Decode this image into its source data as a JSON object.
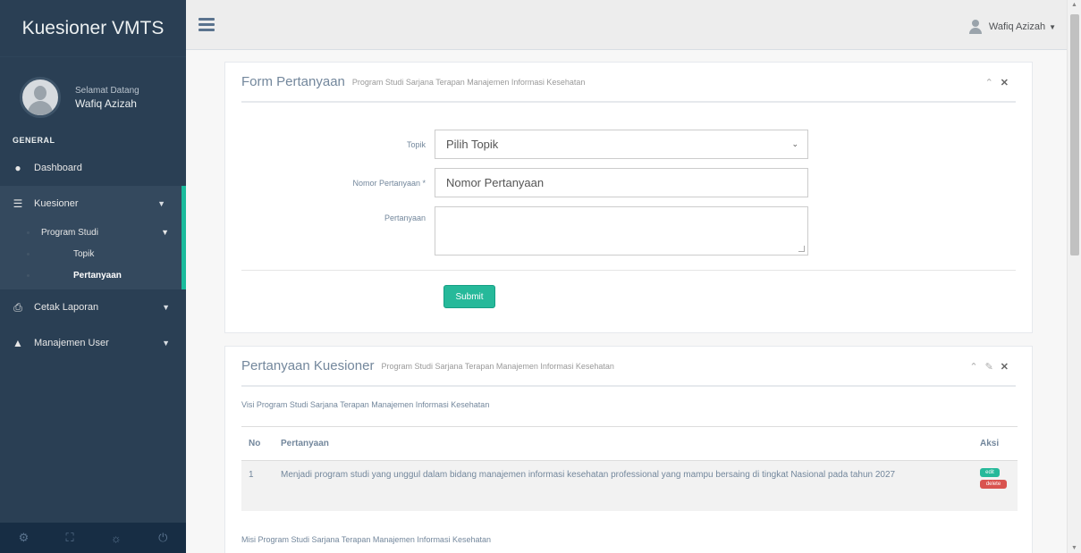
{
  "sidebar": {
    "brand": "Kuesioner VMTS",
    "welcome": "Selamat Datang",
    "user_name": "Wafiq Azizah",
    "section": "GENERAL",
    "menu": {
      "dashboard": "Dashboard",
      "kuesioner": "Kuesioner",
      "program_studi": "Program Studi",
      "topik": "Topik",
      "pertanyaan": "Pertanyaan",
      "cetak_laporan": "Cetak Laporan",
      "manajemen_user": "Manajemen User"
    }
  },
  "topnav": {
    "user_name": "Wafiq Azizah"
  },
  "form_panel": {
    "title": "Form Pertanyaan",
    "subtitle": "Program Studi Sarjana Terapan Manajemen Informasi Kesehatan",
    "topik_label": "Topik",
    "topik_value": "Pilih Topik",
    "nomor_label": "Nomor Pertanyaan *",
    "nomor_placeholder": "Nomor Pertanyaan",
    "pertanyaan_label": "Pertanyaan",
    "submit_label": "Submit"
  },
  "list_panel": {
    "title": "Pertanyaan Kuesioner",
    "subtitle": "Program Studi Sarjana Terapan Manajemen Informasi Kesehatan",
    "visi_heading": "Visi Program Studi Sarjana Terapan Manajemen Informasi Kesehatan",
    "misi_heading": "Misi Program Studi Sarjana Terapan Manajemen Informasi Kesehatan",
    "columns": {
      "no": "No",
      "pertanyaan": "Pertanyaan",
      "aksi": "Aksi"
    },
    "rows": [
      {
        "no": "1",
        "pertanyaan": "Menjadi program studi yang unggul dalam bidang manajemen informasi kesehatan professional yang mampu bersaing di tingkat Nasional pada tahun 2027",
        "edit_label": "edit",
        "delete_label": "delete"
      }
    ]
  },
  "colors": {
    "sidebar": "#2a3f54",
    "accent": "#1abb9c",
    "submit": "#26b99a",
    "delete": "#d9534f"
  }
}
